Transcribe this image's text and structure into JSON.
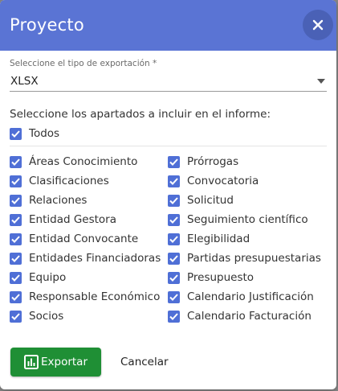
{
  "dialog": {
    "title": "Proyecto",
    "close_icon": "close-icon"
  },
  "export_type": {
    "label": "Seleccione el tipo de exportación *",
    "value": "XLSX"
  },
  "sections": {
    "title": "Seleccione los apartados a incluir en el informe:",
    "all_label": "Todos",
    "left": [
      "Áreas Conocimiento",
      "Clasificaciones",
      "Relaciones",
      "Entidad Gestora",
      "Entidad Convocante",
      "Entidades Financiadoras",
      "Equipo",
      "Responsable Económico",
      "Socios"
    ],
    "right": [
      "Prórrogas",
      "Convocatoria",
      "Solicitud",
      "Seguimiento científico",
      "Elegibilidad",
      "Partidas presupuestarias",
      "Presupuesto",
      "Calendario Justificación",
      "Calendario Facturación"
    ]
  },
  "footer": {
    "export_label": "Exportar",
    "cancel_label": "Cancelar"
  },
  "colors": {
    "header": "#5a74d4",
    "checkbox": "#4f6fd6",
    "export_button": "#1f8f35"
  }
}
